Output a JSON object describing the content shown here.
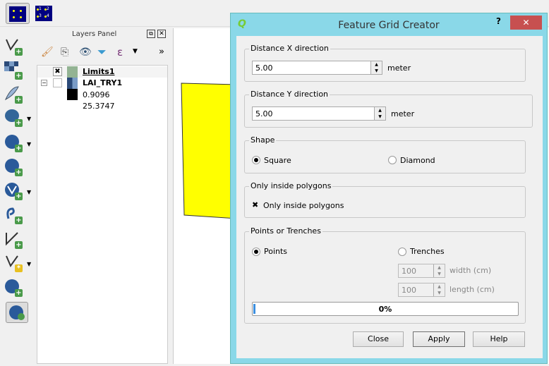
{
  "toolbar": {
    "buttons": [
      {
        "icon": "points-icon"
      },
      {
        "icon": "numbered-points-icon",
        "labels": [
          "1",
          "2",
          "3",
          "4"
        ]
      }
    ]
  },
  "left_toolbar": {
    "icons": [
      "add-vector-layer-icon",
      "add-raster-layer-icon",
      "add-delimited-text-icon",
      "add-postgis-layer-icon",
      "add-wms-layer-icon",
      "add-wcs-layer-icon",
      "add-wfs-layer-icon",
      "add-spatialite-layer-icon",
      "new-shapefile-icon",
      "new-temporary-layer-icon",
      "add-oracle-layer-icon",
      "qgis-browser-icon"
    ]
  },
  "layers_panel": {
    "title": "Layers Panel",
    "more": "»",
    "layers": [
      {
        "name": "Limits1",
        "checked": true,
        "swatch": "#93b393"
      },
      {
        "name": "LAI_TRY1",
        "checked": false
      }
    ],
    "legend": [
      "0.9096",
      "25.3747"
    ]
  },
  "map": {
    "polygon_color": "#ffff00"
  },
  "dialog": {
    "title": "Feature Grid Creator",
    "help": "?",
    "close": "✕",
    "dist_x": {
      "label": "Distance X direction",
      "value": "5.00",
      "unit": "meter"
    },
    "dist_y": {
      "label": "Distance Y direction",
      "value": "5.00",
      "unit": "meter"
    },
    "shape": {
      "label": "Shape",
      "options": [
        "Square",
        "Diamond"
      ],
      "selected": "Square"
    },
    "inside": {
      "label": "Only inside polygons",
      "checkbox": "Only inside polygons",
      "checked": true
    },
    "points": {
      "label": "Points or Trenches",
      "options": [
        "Points",
        "Trenches"
      ],
      "selected": "Points",
      "width": {
        "value": "100",
        "unit": "width (cm)"
      },
      "length": {
        "value": "100",
        "unit": "length (cm)"
      },
      "progress": 0,
      "progress_label": "0%"
    },
    "buttons": {
      "close": "Close",
      "apply": "Apply",
      "help": "Help"
    }
  }
}
